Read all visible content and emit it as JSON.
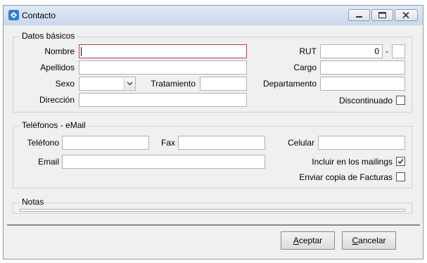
{
  "window": {
    "title": "Contacto"
  },
  "datos_basicos": {
    "legend": "Datos básicos",
    "nombre_label": "Nombre",
    "apellidos_label": "Apellidos",
    "sexo_label": "Sexo",
    "tratamiento_label": "Tratamiento",
    "direccion_label": "Dirección",
    "rut_label": "RUT",
    "rut_value": "0",
    "rut_dash": "-",
    "cargo_label": "Cargo",
    "departamento_label": "Departamento",
    "discontinuado_label": "Discontinuado",
    "discontinuado_checked": false
  },
  "telefonos": {
    "legend": "Teléfonos - eMail",
    "telefono_label": "Teléfono",
    "fax_label": "Fax",
    "celular_label": "Celular",
    "email_label": "Email",
    "mailings_label": "Incluir en los mailings",
    "mailings_checked": true,
    "facturas_label": "Enviar copia de Facturas",
    "facturas_checked": false
  },
  "notas": {
    "legend": "Notas"
  },
  "buttons": {
    "accept_accel": "A",
    "accept_rest": "ceptar",
    "cancel_accel": "C",
    "cancel_rest": "ancelar"
  }
}
